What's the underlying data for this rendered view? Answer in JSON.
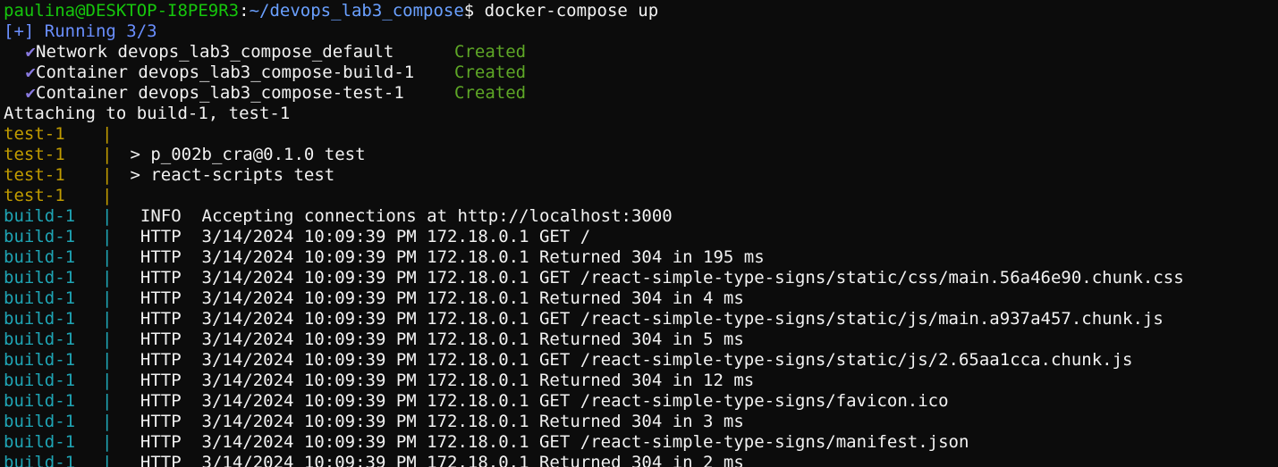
{
  "prompt": {
    "user_host": "paulina@DESKTOP-I8PE9R3",
    "separator": ":",
    "path": "~/devops_lab3_compose",
    "symbol": "$ ",
    "command": "docker-compose up"
  },
  "running": "[+] Running 3/3",
  "resources": [
    {
      "check": "✔",
      "name": "Network devops_lab3_compose_default",
      "status": "Created"
    },
    {
      "check": "✔",
      "name": "Container devops_lab3_compose-build-1",
      "status": "Created"
    },
    {
      "check": "✔",
      "name": "Container devops_lab3_compose-test-1",
      "status": "Created"
    }
  ],
  "attaching": "Attaching to build-1, test-1",
  "pipe": "|",
  "logs": [
    {
      "service": "test-1",
      "text": ""
    },
    {
      "service": "test-1",
      "text": " > p_002b_cra@0.1.0 test"
    },
    {
      "service": "test-1",
      "text": " > react-scripts test"
    },
    {
      "service": "test-1",
      "text": ""
    },
    {
      "service": "build-1",
      "text": "  INFO  Accepting connections at http://localhost:3000"
    },
    {
      "service": "build-1",
      "text": "  HTTP  3/14/2024 10:09:39 PM 172.18.0.1 GET /"
    },
    {
      "service": "build-1",
      "text": "  HTTP  3/14/2024 10:09:39 PM 172.18.0.1 Returned 304 in 195 ms"
    },
    {
      "service": "build-1",
      "text": "  HTTP  3/14/2024 10:09:39 PM 172.18.0.1 GET /react-simple-type-signs/static/css/main.56a46e90.chunk.css"
    },
    {
      "service": "build-1",
      "text": "  HTTP  3/14/2024 10:09:39 PM 172.18.0.1 Returned 304 in 4 ms"
    },
    {
      "service": "build-1",
      "text": "  HTTP  3/14/2024 10:09:39 PM 172.18.0.1 GET /react-simple-type-signs/static/js/main.a937a457.chunk.js"
    },
    {
      "service": "build-1",
      "text": "  HTTP  3/14/2024 10:09:39 PM 172.18.0.1 Returned 304 in 5 ms"
    },
    {
      "service": "build-1",
      "text": "  HTTP  3/14/2024 10:09:39 PM 172.18.0.1 GET /react-simple-type-signs/static/js/2.65aa1cca.chunk.js"
    },
    {
      "service": "build-1",
      "text": "  HTTP  3/14/2024 10:09:39 PM 172.18.0.1 Returned 304 in 12 ms"
    },
    {
      "service": "build-1",
      "text": "  HTTP  3/14/2024 10:09:39 PM 172.18.0.1 GET /react-simple-type-signs/favicon.ico"
    },
    {
      "service": "build-1",
      "text": "  HTTP  3/14/2024 10:09:39 PM 172.18.0.1 Returned 304 in 3 ms"
    },
    {
      "service": "build-1",
      "text": "  HTTP  3/14/2024 10:09:39 PM 172.18.0.1 GET /react-simple-type-signs/manifest.json"
    },
    {
      "service": "build-1",
      "text": "  HTTP  3/14/2024 10:09:39 PM 172.18.0.1 Returned 304 in 2 ms"
    }
  ],
  "colors": {
    "background": "#0c0c0c",
    "prompt_user": "#16c60c",
    "prompt_path": "#6aa0ff",
    "running": "#6a8fff",
    "status_created": "#5ea726",
    "check": "#8a7ae0",
    "test_service": "#c19c00",
    "build_service": "#1fa5b5"
  }
}
